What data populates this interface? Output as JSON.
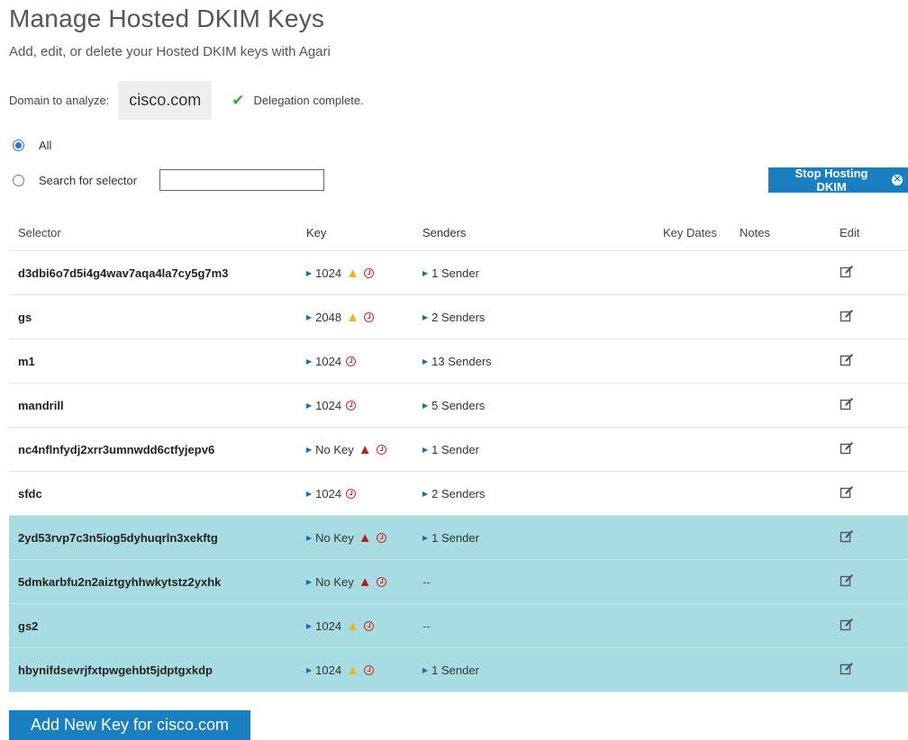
{
  "header": {
    "title": "Manage Hosted DKIM Keys",
    "subtitle": "Add, edit, or delete your Hosted DKIM keys with Agari"
  },
  "domain": {
    "label": "Domain to analyze:",
    "value": "cisco.com",
    "status": "Delegation complete."
  },
  "filter": {
    "all_label": "All",
    "search_label": "Search for selector",
    "search_value": "",
    "selected": "all"
  },
  "actions": {
    "stop_label": "Stop Hosting DKIM",
    "add_label": "Add New Key for cisco.com"
  },
  "table": {
    "headers": {
      "selector": "Selector",
      "key": "Key",
      "senders": "Senders",
      "key_dates": "Key Dates",
      "notes": "Notes",
      "edit": "Edit"
    },
    "rows": [
      {
        "selector": "d3dbi6o7d5i4g4wav7aqa4la7cy5g7m3",
        "key": "1024",
        "warning": "yellow",
        "senders": "1 Sender",
        "highlight": false
      },
      {
        "selector": "gs",
        "key": "2048",
        "warning": "yellow",
        "senders": "2 Senders",
        "highlight": false
      },
      {
        "selector": "m1",
        "key": "1024",
        "warning": "",
        "senders": "13 Senders",
        "highlight": false
      },
      {
        "selector": "mandrill",
        "key": "1024",
        "warning": "",
        "senders": "5 Senders",
        "highlight": false
      },
      {
        "selector": "nc4nflnfydj2xrr3umnwdd6ctfyjepv6",
        "key": "No Key",
        "warning": "red",
        "senders": "1 Sender",
        "highlight": false
      },
      {
        "selector": "sfdc",
        "key": "1024",
        "warning": "",
        "senders": "2 Senders",
        "highlight": false
      },
      {
        "selector": "2yd53rvp7c3n5iog5dyhuqrln3xekftg",
        "key": "No Key",
        "warning": "red",
        "senders": "1 Sender",
        "highlight": true
      },
      {
        "selector": "5dmkarbfu2n2aiztgyhhwkytstz2yxhk",
        "key": "No Key",
        "warning": "red",
        "senders": "--",
        "highlight": true
      },
      {
        "selector": "gs2",
        "key": "1024",
        "warning": "yellow",
        "senders": "--",
        "highlight": true
      },
      {
        "selector": "hbynifdsevrjfxtpwgehbt5jdptgxkdp",
        "key": "1024",
        "warning": "yellow",
        "senders": "1 Sender",
        "highlight": true
      }
    ]
  },
  "icons": {
    "status": "check-icon",
    "key_expand": "caret-right-icon",
    "warning": "warning-triangle-icon",
    "expiry": "clock-icon",
    "edit": "edit-icon",
    "stop": "close-circle-icon"
  },
  "colors": {
    "accent": "#1a7fc1",
    "highlight_row": "#a8dce3",
    "success": "#3aa635",
    "warning": "#f2b41c",
    "danger": "#b8211f"
  }
}
